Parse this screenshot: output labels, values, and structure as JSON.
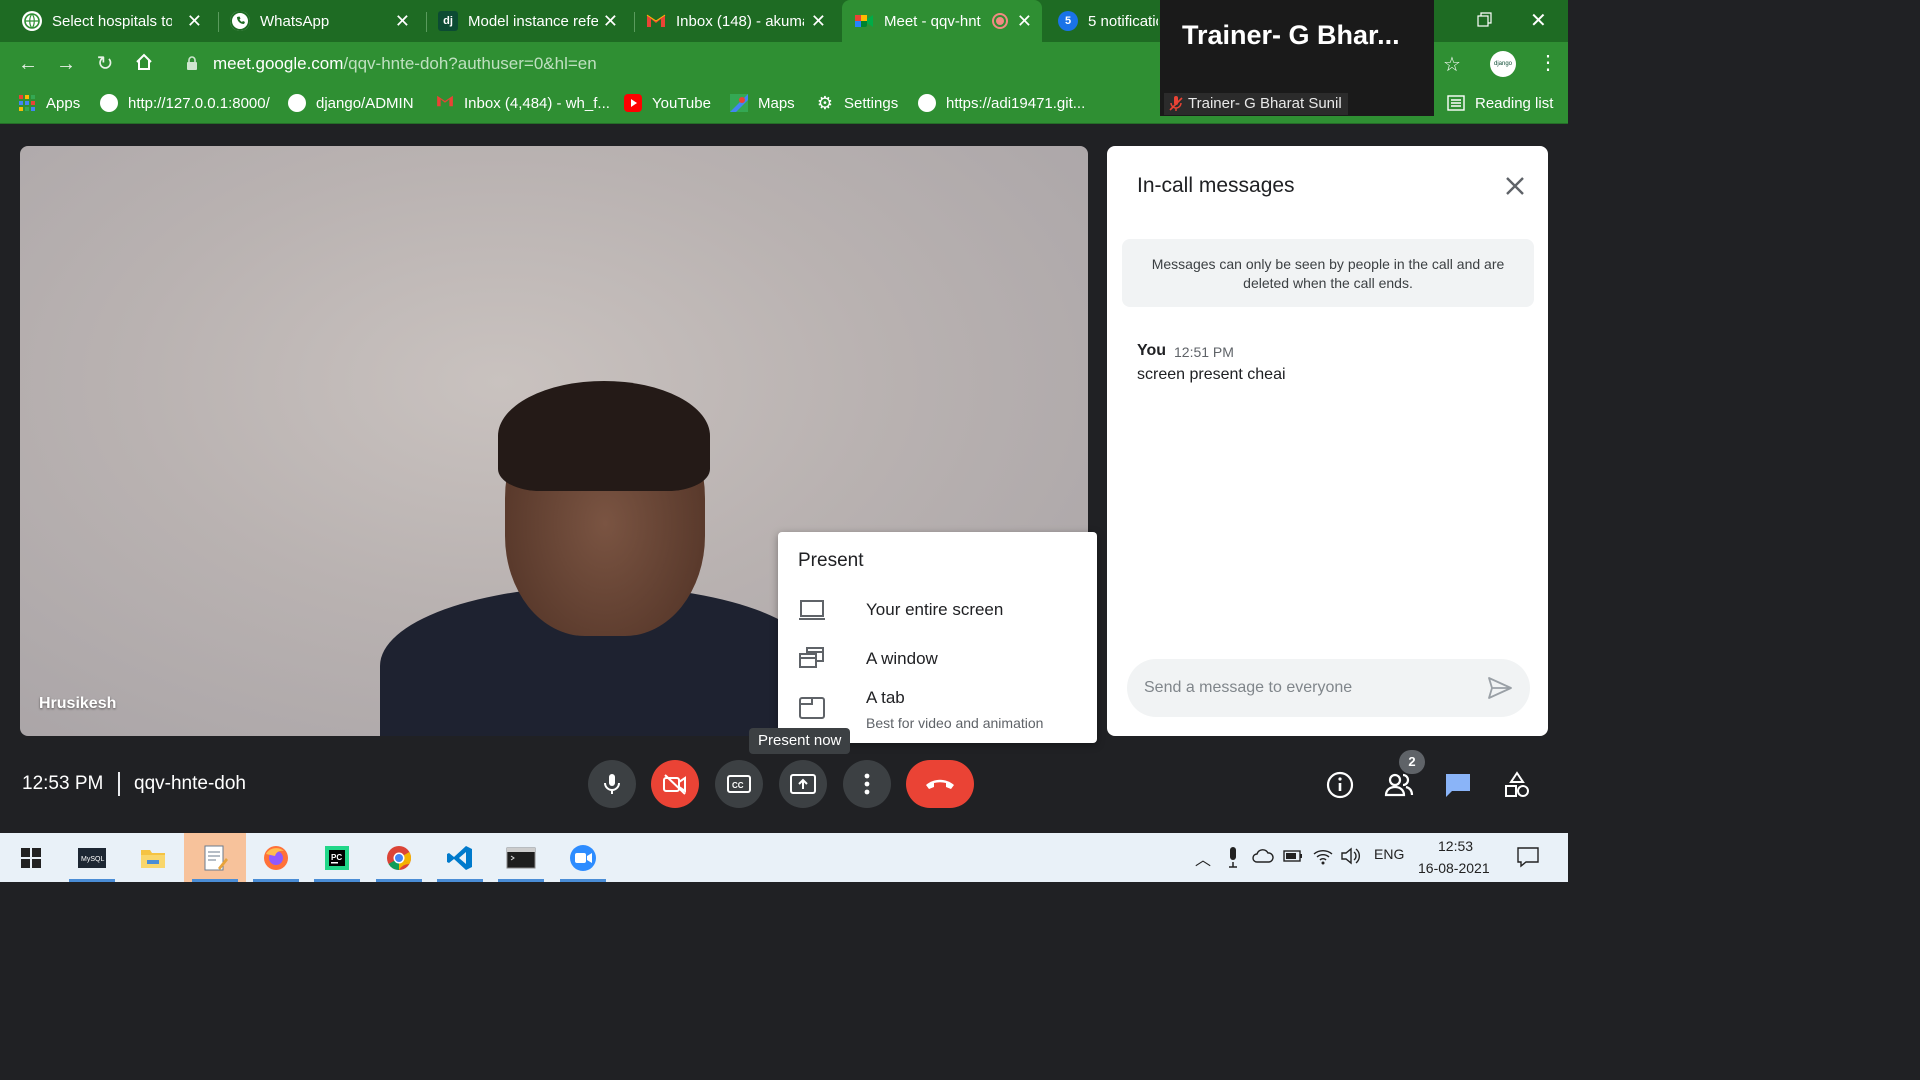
{
  "browser": {
    "tabs": [
      {
        "title": "Select hospitals to c",
        "favicon": "globe-icon"
      },
      {
        "title": "WhatsApp",
        "favicon": "whatsapp-icon"
      },
      {
        "title": "Model instance refe",
        "favicon": "django-icon",
        "fav_text": "dj"
      },
      {
        "title": "Inbox (148) - akuma",
        "favicon": "gmail-icon"
      },
      {
        "title": "Meet - qqv-hnt",
        "favicon": "meet-icon",
        "active": true
      },
      {
        "title": "5 notificatio",
        "favicon": "notification-icon",
        "fav_text": "5"
      }
    ],
    "address": {
      "host": "meet.google.com",
      "path": "/qqv-hnte-doh?authuser=0&hl=en"
    },
    "profile_label": "django",
    "bookmarks": [
      {
        "label": "Apps",
        "icon": "apps-grid-icon"
      },
      {
        "label": "http://127.0.0.1:8000/",
        "icon": "globe-icon"
      },
      {
        "label": "django/ADMIN",
        "icon": "globe-icon"
      },
      {
        "label": "Inbox (4,484) - wh_f...",
        "icon": "gmail-icon"
      },
      {
        "label": "YouTube",
        "icon": "youtube-icon"
      },
      {
        "label": "Maps",
        "icon": "maps-icon"
      },
      {
        "label": "Settings",
        "icon": "gear-icon"
      },
      {
        "label": "https://adi19471.git...",
        "icon": "globe-icon"
      }
    ],
    "reading_list": "Reading list"
  },
  "pip": {
    "title": "Trainer-  G  Bhar...",
    "label": "Trainer- G Bharat Sunil"
  },
  "meet": {
    "participant_name": "Hrusikesh",
    "present_menu": {
      "heading": "Present",
      "items": [
        {
          "label": "Your entire screen",
          "icon": "monitor-icon"
        },
        {
          "label": "A window",
          "icon": "window-icon"
        },
        {
          "label": "A tab",
          "sub": "Best for video and animation",
          "icon": "tab-icon"
        }
      ]
    },
    "tooltip": "Present now",
    "chat": {
      "title": "In-call messages",
      "notice": "Messages can only be seen by people in the call and are deleted when the call ends.",
      "messages": [
        {
          "sender": "You",
          "time": "12:51 PM",
          "text": "screen present cheai"
        }
      ],
      "input_placeholder": "Send a message to everyone"
    },
    "time": "12:53 PM",
    "code": "qqv-hnte-doh",
    "people_count": "2"
  },
  "taskbar": {
    "apps": [
      "windows-start-icon",
      "mysql-icon",
      "file-explorer-icon",
      "notepad-icon",
      "firefox-icon",
      "pycharm-icon",
      "chrome-icon",
      "vscode-icon",
      "terminal-icon",
      "zoom-icon"
    ],
    "language": "ENG",
    "clock_time": "12:53",
    "clock_date": "16-08-2021"
  },
  "colors": {
    "chrome_green": "#2f8f33",
    "meet_bg": "#202124",
    "danger": "#ea4335",
    "accent_blue": "#1a73e8"
  }
}
